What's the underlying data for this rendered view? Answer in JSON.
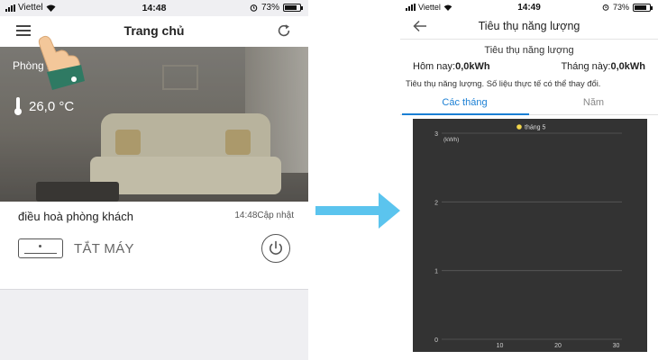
{
  "left_phone": {
    "status": {
      "carrier": "Viettel",
      "time": "14:48",
      "battery": "73%",
      "battery_level": 0.73
    },
    "nav": {
      "title": "Trang chủ"
    },
    "room": {
      "name": "Phòng khách",
      "temperature": "26,0 °C"
    },
    "device": {
      "name": "điều hoà phòng khách",
      "updated": "14:48Cập nhật",
      "state": "TẮT MÁY"
    }
  },
  "right_phone": {
    "status": {
      "carrier": "Viettel",
      "time": "14:49",
      "battery": "73%",
      "battery_level": 0.73
    },
    "nav": {
      "title": "Tiêu thụ năng lượng"
    },
    "section_title": "Tiêu thụ năng lượng",
    "today_label": "Hôm nay:",
    "today_value": "0,0kWh",
    "month_label": "Tháng này:",
    "month_value": "0,0kWh",
    "note": "Tiêu thụ năng lượng. Số liệu thực tế có thể thay đổi.",
    "tabs": [
      {
        "label": "Các tháng",
        "active": true
      },
      {
        "label": "Năm",
        "active": false
      }
    ]
  },
  "chart_data": {
    "type": "line",
    "title": "",
    "ylabel": "(kWh)",
    "xlabel": "",
    "series": [
      {
        "name": "tháng 5",
        "color": "#f2d64b",
        "x": [],
        "y": []
      }
    ],
    "xlim": [
      0,
      31
    ],
    "ylim": [
      0,
      3
    ],
    "xticks": [
      10,
      20,
      30
    ],
    "yticks": [
      0,
      1,
      2,
      3
    ],
    "grid": true,
    "legend": "top-center",
    "background": "#333333"
  },
  "colors": {
    "accent": "#1a7fd4",
    "arrow": "#5bc4ee",
    "chart_bg": "#333333"
  }
}
